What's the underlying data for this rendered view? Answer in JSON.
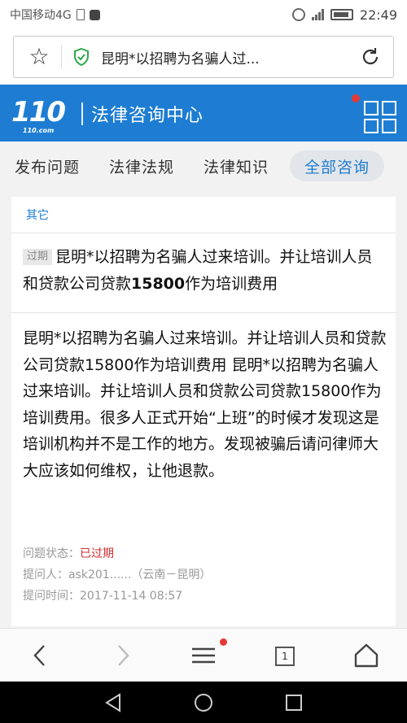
{
  "status_bar": {
    "carrier": "中国移动4G",
    "time": "22:49",
    "network_type": "4G",
    "icons": [
      "sim-icon",
      "tiktok-icon",
      "alarm-icon",
      "signal-icon",
      "battery-icon"
    ]
  },
  "address_bar": {
    "page_title": "昆明*以招聘为名骗人过...",
    "icons": [
      "star-icon",
      "shield-check-icon",
      "refresh-icon"
    ]
  },
  "header": {
    "logo_text": "110",
    "logo_sub": "110.com",
    "title": "法律咨询中心",
    "icons": [
      "grid-menu-icon"
    ]
  },
  "tabs": [
    {
      "label": "发布问题",
      "active": false
    },
    {
      "label": "法律法规",
      "active": false
    },
    {
      "label": "法律知识",
      "active": false
    },
    {
      "label": "全部咨询",
      "active": true
    }
  ],
  "question": {
    "category": "其它",
    "expired_tag": "过期",
    "title_part1": "昆明*以招聘为名骗人过来培训。并让培训人员和贷款公司贷款",
    "title_bold": "15800",
    "title_part2": "作为培训费用",
    "body": "昆明*以招聘为名骗人过来培训。并让培训人员和贷款公司贷款15800作为培训费用 昆明*以招聘为名骗人过来培训。并让培训人员和贷款公司贷款15800作为培训费用。很多人正式开始“上班”的时候才发现这是培训机构并不是工作的地方。发现被骗后请问律师大大应该如何维权，让他退款。",
    "status_label": "问题状态：",
    "status_value": "已过期",
    "asker_label": "提问人：",
    "asker_value": "ask201......（云南－昆明）",
    "time_label": "提问时间：",
    "time_value": "2017-11-14 08:57"
  },
  "browser_bar": {
    "tab_count": "1",
    "icons": [
      "back-icon",
      "forward-icon",
      "menu-icon",
      "tabs-icon",
      "home-icon"
    ]
  },
  "android_nav": {
    "icons": [
      "android-back-icon",
      "android-home-icon",
      "android-recents-icon"
    ]
  },
  "colors": {
    "brand_blue": "#1e7dd2",
    "expired_red": "#d32f2f",
    "notification_red": "#e53935"
  }
}
